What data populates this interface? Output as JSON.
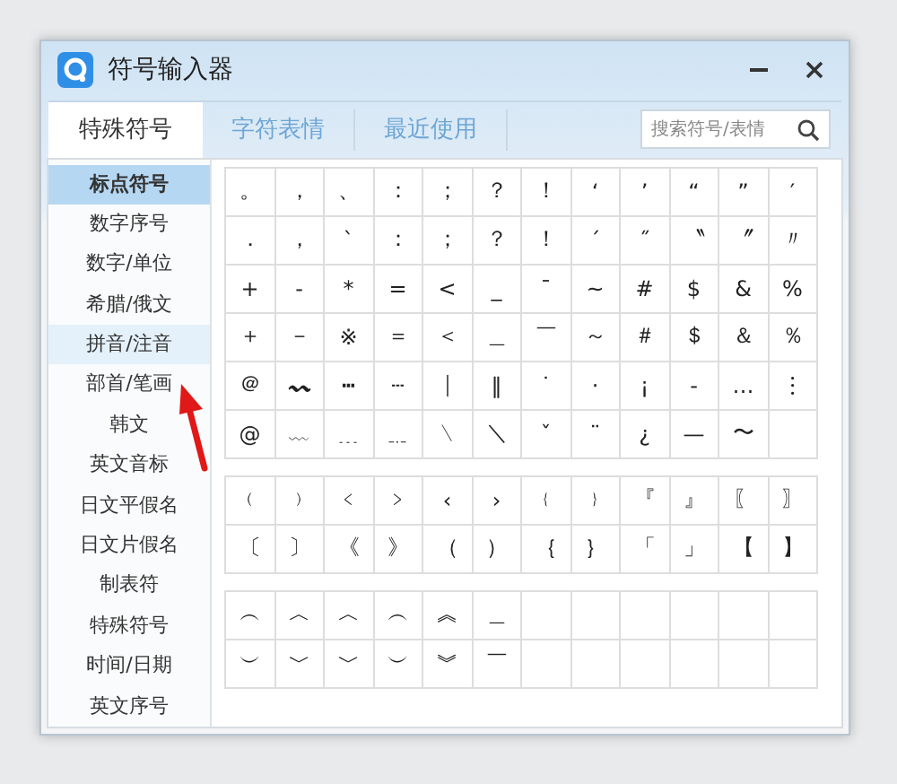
{
  "window": {
    "title": "符号输入器"
  },
  "tabs": [
    {
      "label": "特殊符号",
      "selected": true
    },
    {
      "label": "字符表情",
      "selected": false
    },
    {
      "label": "最近使用",
      "selected": false
    }
  ],
  "search": {
    "placeholder": "搜索符号/表情"
  },
  "sidebar": {
    "items": [
      {
        "label": "标点符号",
        "selected": true,
        "highlighted": false
      },
      {
        "label": "数字序号",
        "selected": false,
        "highlighted": false
      },
      {
        "label": "数字/单位",
        "selected": false,
        "highlighted": false
      },
      {
        "label": "希腊/俄文",
        "selected": false,
        "highlighted": false
      },
      {
        "label": "拼音/注音",
        "selected": false,
        "highlighted": true
      },
      {
        "label": "部首/笔画",
        "selected": false,
        "highlighted": false
      },
      {
        "label": "韩文",
        "selected": false,
        "highlighted": false
      },
      {
        "label": "英文音标",
        "selected": false,
        "highlighted": false
      },
      {
        "label": "日文平假名",
        "selected": false,
        "highlighted": false
      },
      {
        "label": "日文片假名",
        "selected": false,
        "highlighted": false
      },
      {
        "label": "制表符",
        "selected": false,
        "highlighted": false
      },
      {
        "label": "特殊符号",
        "selected": false,
        "highlighted": false
      },
      {
        "label": "时间/日期",
        "selected": false,
        "highlighted": false
      },
      {
        "label": "英文序号",
        "selected": false,
        "highlighted": false
      }
    ]
  },
  "symbol_groups": [
    {
      "rows": [
        [
          "。",
          "，",
          "、",
          "：",
          "；",
          "？",
          "！",
          "‘",
          "’",
          "“",
          "”",
          "′"
        ],
        [
          "．",
          "，",
          "ˋ",
          "：",
          "；",
          "？",
          "！",
          "ˊ",
          "˝",
          "〝",
          "〞",
          "〃"
        ],
        [
          "+",
          "-",
          "*",
          "=",
          "<",
          "_",
          "¯",
          "~",
          "#",
          "$",
          "&",
          "%"
        ],
        [
          "＋",
          "－",
          "※",
          "＝",
          "＜",
          "＿",
          "￣",
          "～",
          "＃",
          "＄",
          "＆",
          "％"
        ],
        [
          "＠",
          "〰",
          "┅",
          "┄",
          "｜",
          "‖",
          "˙",
          "·",
          "¡",
          "‐",
          "…",
          "︙"
        ],
        [
          "@",
          "﹏",
          "﹍",
          "﹎",
          "﹨",
          "＼",
          "ˇ",
          "¨",
          "¿",
          "—",
          "〜"
        ]
      ]
    },
    {
      "rows": [
        [
          "﹙",
          "﹚",
          "﹤",
          "﹥",
          "‹",
          "›",
          "﹛",
          "﹜",
          "『",
          "』",
          "〖",
          "〗"
        ],
        [
          "〔",
          "〕",
          "《",
          "》",
          "（",
          "）",
          "｛",
          "｝",
          "「",
          "」",
          "【",
          "】"
        ]
      ]
    },
    {
      "rows": [
        [
          "︵",
          "︿",
          "︿",
          "︵",
          "︽",
          "＿"
        ],
        [
          "︶",
          "﹀",
          "﹀",
          "︶",
          "︾",
          "￣"
        ]
      ]
    }
  ],
  "annotation": {
    "kind": "arrow"
  }
}
